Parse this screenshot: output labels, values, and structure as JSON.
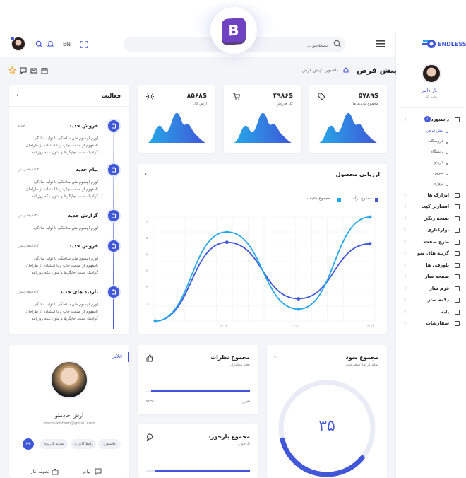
{
  "brand": {
    "name": "ENDLESS"
  },
  "search": {
    "placeholder": "جستجو..."
  },
  "topbar": {
    "lang": "EN"
  },
  "user": {
    "name": "پارادایم",
    "role": "مدیر کل"
  },
  "page": {
    "title": "پیش فرض",
    "breadcrumb": [
      "داشبورد",
      "پیش فرض"
    ],
    "sep": "/"
  },
  "sidebar": {
    "items": [
      {
        "label": "داشبورد",
        "badge": "۶"
      },
      {
        "label": "پیش فرض"
      },
      {
        "label": "فروشگاه"
      },
      {
        "label": "دانشگاه"
      },
      {
        "label": "کریپتو"
      },
      {
        "label": "سرور"
      },
      {
        "label": "پروژه"
      },
      {
        "label": "ابزارک ها"
      },
      {
        "label": "استارتر کیت"
      },
      {
        "label": "نسخه رنگی"
      },
      {
        "label": "نوارکناری"
      },
      {
        "label": "طرح صفحه"
      },
      {
        "label": "گزینه های منو"
      },
      {
        "label": "پاورقی ها"
      },
      {
        "label": "صفحه ساز"
      },
      {
        "label": "فرم ساز"
      },
      {
        "label": "دکمه ساز"
      },
      {
        "label": "پایه"
      },
      {
        "label": "سفارشات"
      }
    ]
  },
  "stats": [
    {
      "value": "۵۷۸۹$",
      "label": "مجموع بازدید ها",
      "icon": "tag-icon"
    },
    {
      "value": "۴۹۸۶$",
      "label": "کل فروش",
      "icon": "cart-icon"
    },
    {
      "value": "۸۵۶۸$",
      "label": "ارش کل",
      "icon": "sun-icon"
    }
  ],
  "product": {
    "title": "ارزیابی محصول",
    "legend": [
      "مجموع درآمد",
      "مجموع مالیات"
    ]
  },
  "chart_data": {
    "type": "line",
    "series": [
      {
        "name": "مجموع درآمد",
        "color": "#4057d8",
        "values": [
          0,
          5.3,
          1.5,
          5.2
        ]
      },
      {
        "name": "مجموع مالیات",
        "color": "#26a8e8",
        "values": [
          0,
          6,
          0.8,
          7
        ]
      }
    ],
    "xlabels": [
      "۲۰۰۸",
      "۲۰۱۰",
      "۲۰۱۲"
    ],
    "yticks": [
      "۶",
      "۵",
      "۴",
      "۳",
      "۲",
      "۱",
      "۰"
    ],
    "ylim": [
      0,
      7
    ]
  },
  "activity": {
    "title": "فعالیت",
    "items": [
      {
        "title": "فروش جدید",
        "time": "جدید",
        "text": [
          "لورم ایپسوم متن ساختگی با تولید سادگی",
          "نامفهوم از صنعت چاپ و با استفاده از طراحان",
          "گرافیک است. چاپگرها و متون بلکه روزنامه"
        ]
      },
      {
        "title": "پیام جدید",
        "time": "۱۴دقیقه پیش",
        "text": [
          "لورم ایپسوم متن ساختگی با تولید سادگی",
          "نامفهوم از صنعت چاپ و با استفاده از طراحان",
          "گرافیک است. چاپگرها و متون بلکه روزنامه"
        ]
      },
      {
        "title": "گزارش جدید",
        "time": "۲۰دقیقه پیش",
        "text": [
          "لورم ایپسوم متن ساختگی با تولید سادگی."
        ]
      },
      {
        "title": "فروش جدید",
        "time": "۱۴دقیقه پیش",
        "text": [
          "لورم ایپسوم متن ساختگی با تولید سادگی",
          "نامفهوم از صنعت چاپ و با استفاده از طراحان",
          "گرافیک است. چاپگرها و متون بلکه روزنامه"
        ]
      },
      {
        "title": "بازدید های جدید",
        "time": "۱۴دقیقه پیش",
        "text": [
          "لورم ایپسوم متن ساختگی با تولید سادگی",
          "نامفهوم از صنعت چاپ و با استفاده از طراحان",
          "گرافیک است. چاپگرها و متون بلکه روزنامه"
        ]
      }
    ]
  },
  "profile": {
    "status": "آنلاین",
    "name": "آرش خادملو",
    "email": "marshikisteen@gmail.com",
    "tags": [
      "داشبورد",
      "رابط کاربری",
      "تجربه کاربری"
    ],
    "count": "۶+",
    "actions": [
      "پیام",
      "نمونه کار"
    ]
  },
  "comments": {
    "title": "مجموع نظرات",
    "subtitle": "نظر مشتری",
    "label": "تغییر",
    "percent": "۹۵%",
    "progress": 0.95
  },
  "feedback": {
    "title": "مجموع بازخورد",
    "subtitle": "بازخورد",
    "progress": 0.92
  },
  "profit": {
    "title": "مجموع سود",
    "subtitle": "تمام درآمد سفارشی",
    "value": "۳۵",
    "fraction": 0.35
  },
  "colors": {
    "primary": "#4057d8",
    "accent": "#26a8e8",
    "warn": "#f5a623"
  }
}
